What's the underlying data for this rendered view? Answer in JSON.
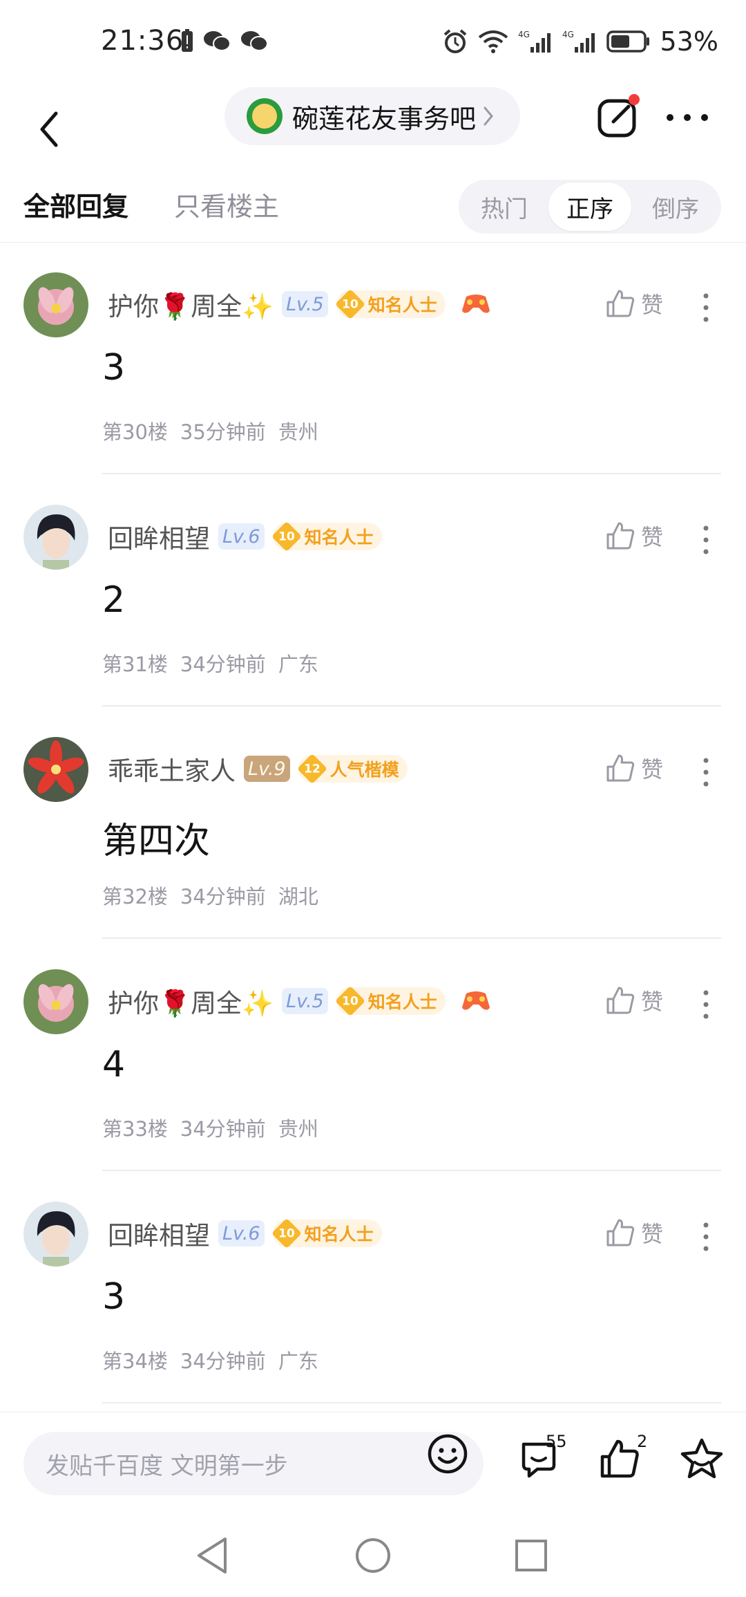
{
  "status_bar": {
    "time": "21:36",
    "battery": "53%"
  },
  "header": {
    "forum_name": "碗莲花友事务吧"
  },
  "tabs": {
    "all": "全部回复",
    "owner_only": "只看楼主"
  },
  "sort": {
    "hot": "热门",
    "asc": "正序",
    "desc": "倒序",
    "active": "正序"
  },
  "like_label": "赞",
  "replies": [
    {
      "user": "护你🌹周全✨",
      "level": "Lv.5",
      "title_level": "10",
      "title": "知名人士",
      "content": "3",
      "floor": "第30楼",
      "time": "35分钟前",
      "location": "贵州"
    },
    {
      "user": "回眸相望",
      "level": "Lv.6",
      "title_level": "10",
      "title": "知名人士",
      "content": "2",
      "floor": "第31楼",
      "time": "34分钟前",
      "location": "广东"
    },
    {
      "user": "乖乖土家人",
      "level": "Lv.9",
      "title_level": "12",
      "title": "人气楷模",
      "content": "第四次",
      "floor": "第32楼",
      "time": "34分钟前",
      "location": "湖北"
    },
    {
      "user": "护你🌹周全✨",
      "level": "Lv.5",
      "title_level": "10",
      "title": "知名人士",
      "content": "4",
      "floor": "第33楼",
      "time": "34分钟前",
      "location": "贵州"
    },
    {
      "user": "回眸相望",
      "level": "Lv.6",
      "title_level": "10",
      "title": "知名人士",
      "content": "3",
      "floor": "第34楼",
      "time": "34分钟前",
      "location": "广东"
    }
  ],
  "bottom_bar": {
    "input_placeholder": "发贴千百度 文明第一步",
    "comment_count": "55",
    "like_count": "2"
  },
  "colors": {
    "accent_red": "#f23c3c",
    "title_gold": "#f2a01d"
  }
}
